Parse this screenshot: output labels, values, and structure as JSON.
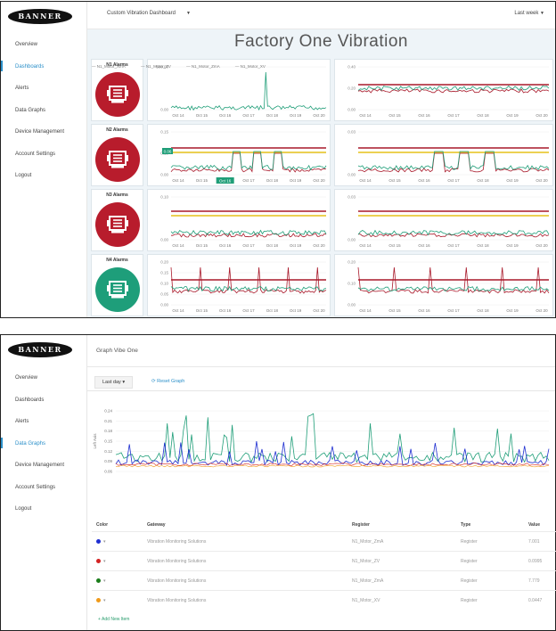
{
  "app": {
    "logo_text": "BANNER"
  },
  "nav": [
    "Overview",
    "Dashboards",
    "Alerts",
    "Data Graphs",
    "Device Management",
    "Account Settings",
    "Logout"
  ],
  "dashboard": {
    "selector_label": "Custom Vibration Dashboard",
    "period": "Last week",
    "title": "Factory One Vibration",
    "alarms": [
      {
        "label": "N1 Alarms",
        "status": "alarm"
      },
      {
        "label": "N2 Alarms",
        "status": "alarm"
      },
      {
        "label": "N3 Alarms",
        "status": "alarm"
      },
      {
        "label": "N4 Alarms",
        "status": "ok"
      }
    ],
    "date_ticks_a": [
      "Oct 14",
      "Oct 15",
      "Oct 16",
      "Oct 17",
      "Oct 18",
      "Oct 19",
      "Oct 20"
    ],
    "date_ticks_b": [
      "Oct 14",
      "Oct 15",
      "Oct 16",
      "Oct 17",
      "Oct 18",
      "Oct 19",
      "Oct 20"
    ],
    "charts": [
      {
        "ticks": [
          "500.00",
          "0.00"
        ]
      },
      {
        "ticks": [
          "0.40",
          "0.20",
          "0.00"
        ]
      },
      {
        "ticks": [
          "0.15",
          "0.10",
          "0.00"
        ],
        "highlight_value": "0.06",
        "highlight_date": "Oct 16"
      },
      {
        "ticks": [
          "0.03",
          "0.00"
        ]
      },
      {
        "ticks": [
          "0.10",
          "0.00"
        ]
      },
      {
        "ticks": [
          "0.03",
          "0.00"
        ]
      },
      {
        "ticks": [
          "0.20",
          "0.15",
          "0.10",
          "0.05",
          "0.00"
        ]
      },
      {
        "ticks": [
          "0.20",
          "0.10",
          "0.00"
        ]
      }
    ]
  },
  "graph": {
    "title": "Graph Vibe One",
    "range_button": "Last day",
    "reset_label": "Reset Graph",
    "legend": [
      "N1_Motor_XmA",
      "N1_Motor_ZV",
      "N1_Motor_ZmA",
      "N1_Motor_XV"
    ],
    "ylabel": "Left Axis",
    "yticks": [
      "0.24",
      "0.21",
      "0.18",
      "0.15",
      "0.12",
      "0.09",
      "0.06"
    ],
    "columns": [
      "Color",
      "Gateway",
      "Register",
      "Type",
      "Value"
    ],
    "rows": [
      {
        "color": "#1f2fd1",
        "gateway": "Vibration Monitoring Solutions",
        "register": "N1_Motor_ZmA",
        "type": "Register",
        "value": "7.001"
      },
      {
        "color": "#d32222",
        "gateway": "Vibration Monitoring Solutions",
        "register": "N1_Motor_ZV",
        "type": "Register",
        "value": "0.0995"
      },
      {
        "color": "#1b7d1b",
        "gateway": "Vibration Monitoring Solutions",
        "register": "N1_Motor_ZmA",
        "type": "Register",
        "value": "7.779"
      },
      {
        "color": "#f09a1a",
        "gateway": "Vibration Monitoring Solutions",
        "register": "N1_Motor_XV",
        "type": "Register",
        "value": "0.0447"
      }
    ],
    "add_row": "Add New Item"
  },
  "colors": {
    "accent": "#2a8fc9",
    "alarm": "#b81c2c",
    "ok": "#1e9e7a",
    "line_red": "#a9192a",
    "line_green": "#1f9e78",
    "line_yellow": "#e6c21a"
  }
}
